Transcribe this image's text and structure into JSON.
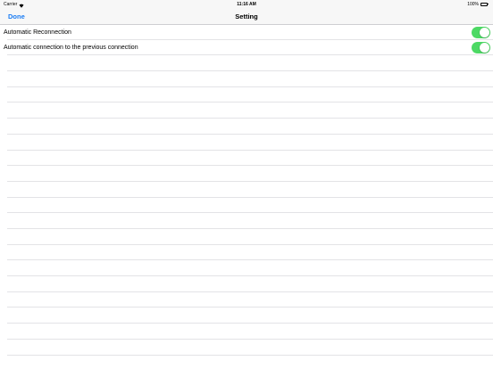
{
  "status_bar": {
    "carrier": "Carrier",
    "time": "11:16 AM",
    "battery": "100%",
    "wifi_icon": "wifi-icon",
    "battery_icon": "battery-icon"
  },
  "nav": {
    "done_label": "Done",
    "title": "Setting"
  },
  "settings": [
    {
      "label": "Automatic Reconnection",
      "on": true
    },
    {
      "label": "Automatic connection to the previous connection",
      "on": true
    }
  ],
  "colors": {
    "accent": "#1a7cf4",
    "toggle_on": "#4cd964",
    "bar_background": "#f7f7f7",
    "separator": "#e3e3e6"
  }
}
